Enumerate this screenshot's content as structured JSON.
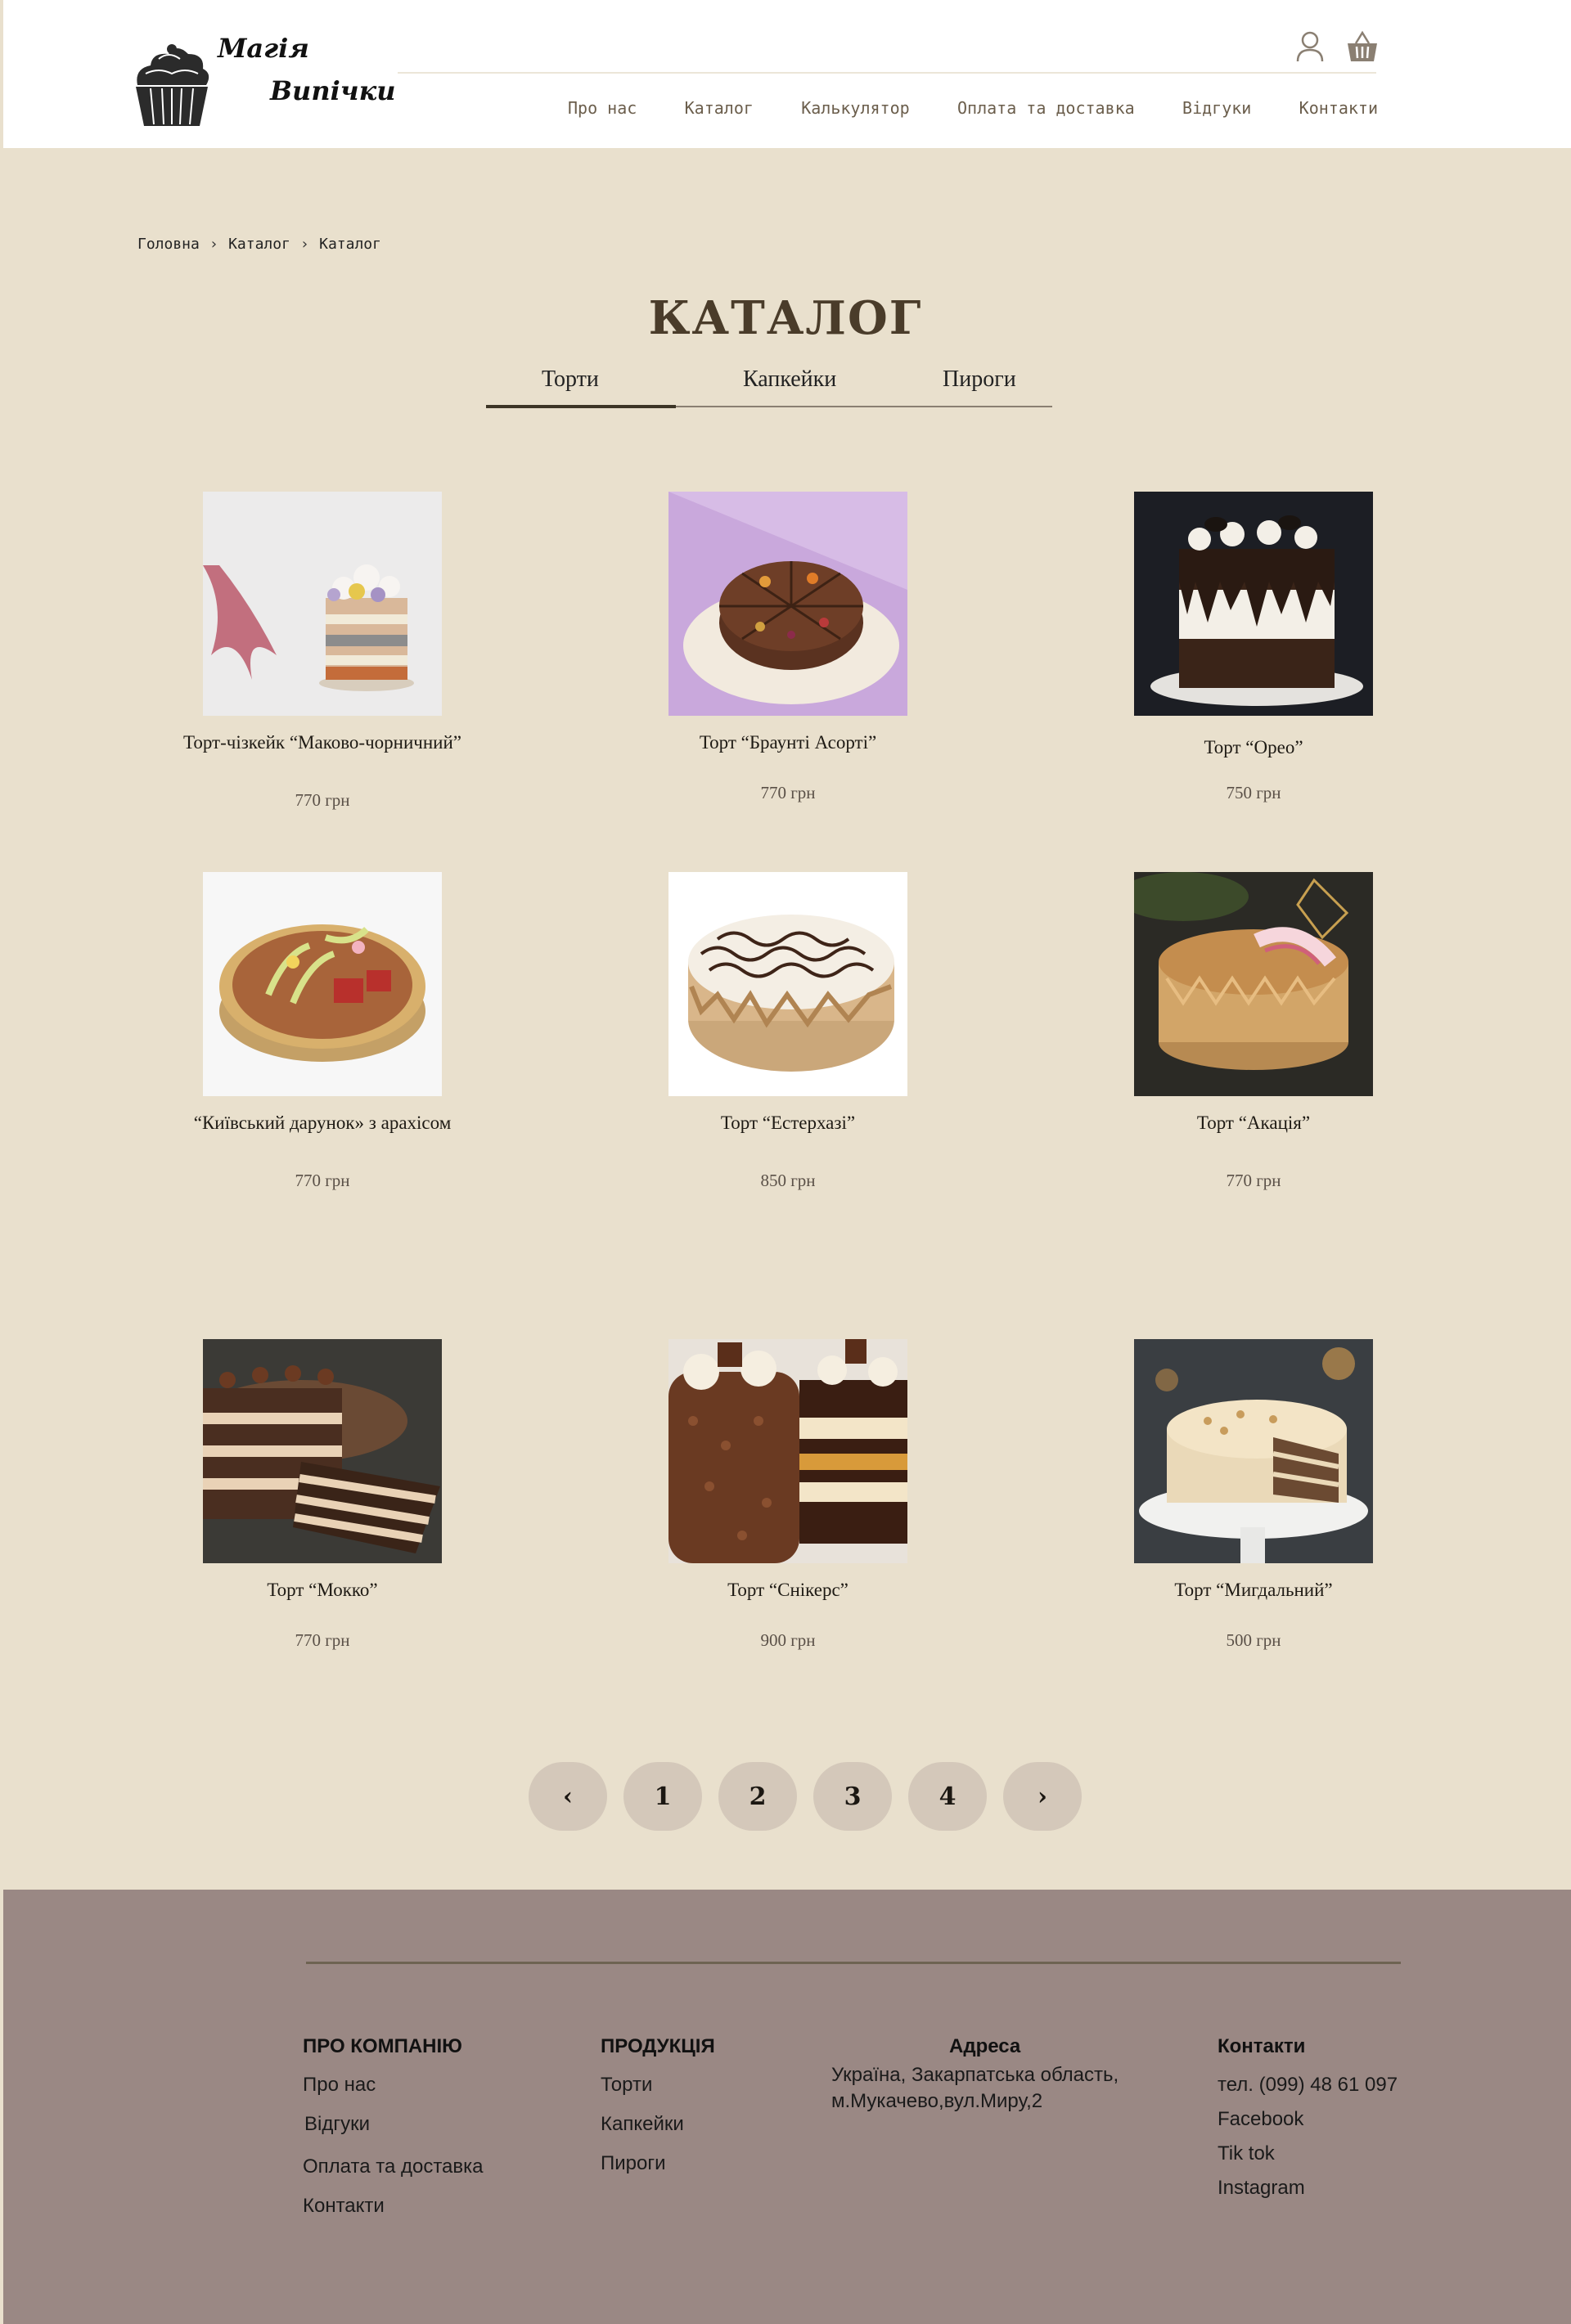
{
  "brand": {
    "line1": "Магія",
    "line2": "Випічки"
  },
  "header": {
    "nav": [
      "Про нас",
      "Каталог",
      "Калькулятор",
      "Оплата та доставка",
      "Відгуки",
      "Контакти"
    ],
    "icons": [
      "user-icon",
      "basket-icon"
    ]
  },
  "breadcrumb": [
    "Головна",
    "Каталог",
    "Каталог"
  ],
  "page_title": "КАТАЛОГ",
  "tabs": [
    "Торти",
    "Капкейки",
    "Пироги"
  ],
  "active_tab": "Торти",
  "products": [
    {
      "name": "Торт-чізкейк “Маково-чорничний”",
      "price": "770 грн"
    },
    {
      "name": "Торт “Браунті Асорті”",
      "price": "770 грн"
    },
    {
      "name": "Торт “Орео”",
      "price": "750 грн"
    },
    {
      "name": "“Київський дарунок» з арахісом",
      "price": "770 грн"
    },
    {
      "name": "Торт “Естерхазі”",
      "price": "850 грн"
    },
    {
      "name": "Торт “Акація”",
      "price": "770 грн"
    },
    {
      "name": "Торт “Мокко”",
      "price": "770 грн"
    },
    {
      "name": "Торт “Снікерс”",
      "price": "900 грн"
    },
    {
      "name": "Торт “Мигдальний”",
      "price": "500 грн"
    }
  ],
  "pagination": {
    "prev": "‹",
    "pages": [
      "1",
      "2",
      "3",
      "4"
    ],
    "next": "›"
  },
  "footer": {
    "company": {
      "title": "ПРО КОМПАНІЮ",
      "links": [
        "Про нас",
        "Відгуки",
        "Оплата та доставка",
        "Контакти"
      ]
    },
    "products": {
      "title": "ПРОДУКЦІЯ",
      "links": [
        "Торти",
        "Капкейки",
        "Пироги"
      ]
    },
    "address": {
      "title": "Адреса",
      "line1": "Україна, Закарпатська область,",
      "line2": "м.Мукачево,вул.Миру,2"
    },
    "contacts": {
      "title": "Контакти",
      "phone": "тел. (099) 48 61 097",
      "links": [
        "Facebook",
        "Tik tok",
        "Instagram"
      ]
    }
  },
  "colors": {
    "background": "#e9e0cd",
    "footer": "#9a8884",
    "pagination": "#d4c8ba"
  }
}
